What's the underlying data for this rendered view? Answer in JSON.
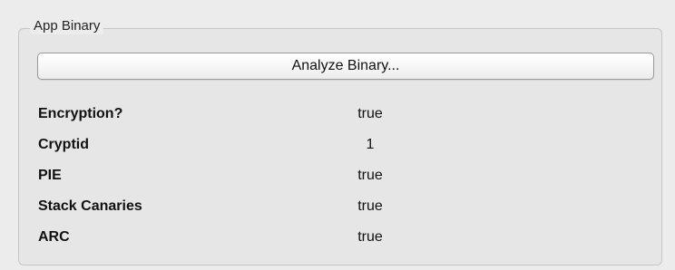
{
  "group": {
    "title": "App Binary"
  },
  "analyze_button_label": "Analyze Binary...",
  "properties": [
    {
      "label": "Encryption?",
      "value": "true"
    },
    {
      "label": "Cryptid",
      "value": "1"
    },
    {
      "label": "PIE",
      "value": "true"
    },
    {
      "label": "Stack Canaries",
      "value": "true"
    },
    {
      "label": "ARC",
      "value": "true"
    }
  ]
}
